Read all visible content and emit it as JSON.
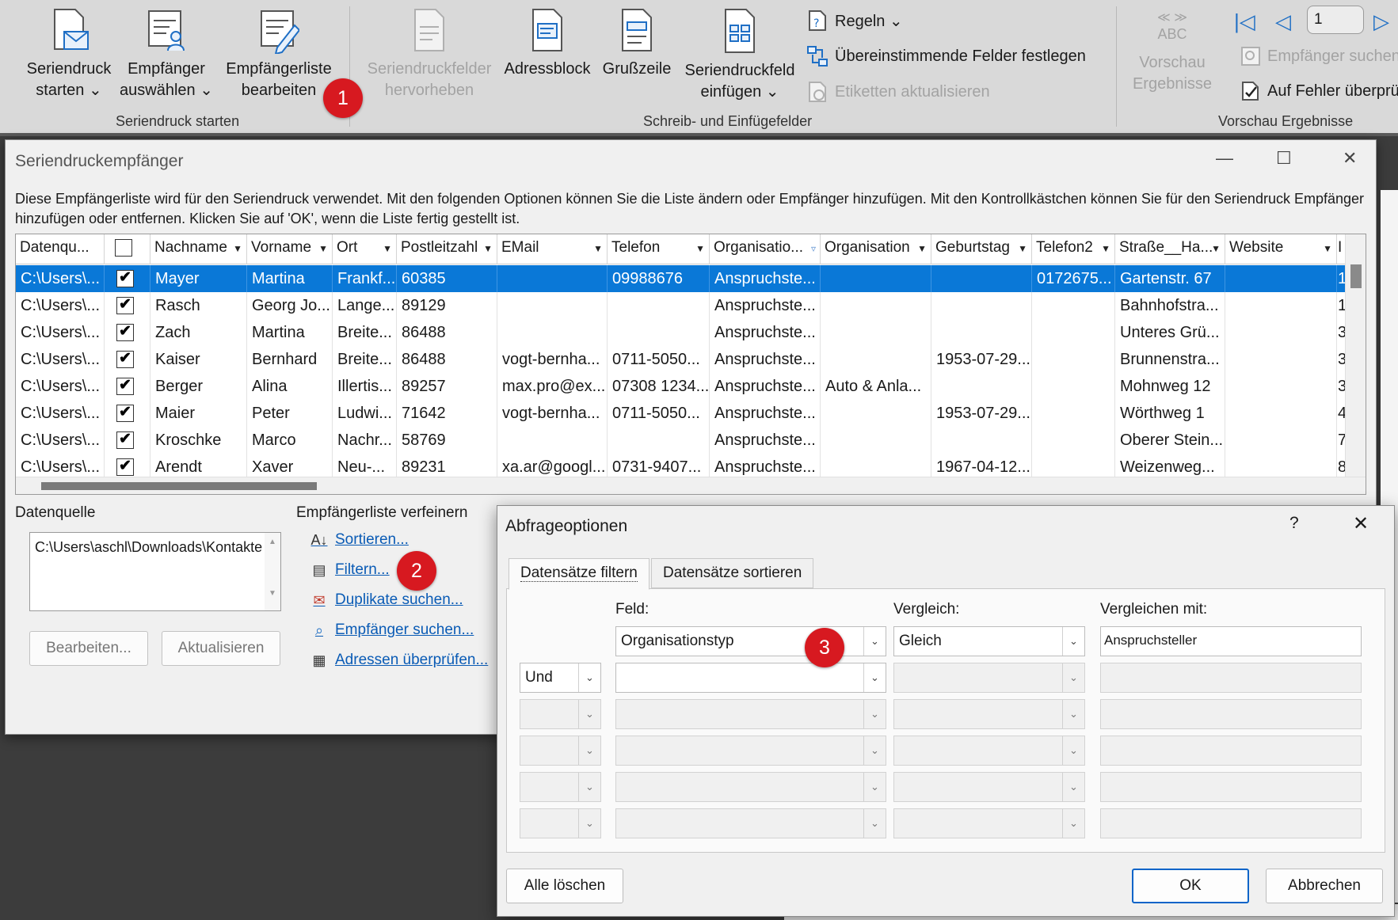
{
  "ribbon": {
    "group1": {
      "label": "Seriendruck starten",
      "btn1": {
        "l1": "Seriendruck",
        "l2": "starten ⌄",
        "icon": "mail-merge-start-icon"
      },
      "btn2": {
        "l1": "Empfänger",
        "l2": "auswählen ⌄",
        "icon": "select-recipients-icon"
      },
      "btn3": {
        "l1": "Empfängerliste",
        "l2": "bearbeiten",
        "icon": "edit-recipient-list-icon"
      }
    },
    "group2": {
      "label": "Schreib- und Einfügefelder",
      "btn1": {
        "l1": "Seriendruckfelder",
        "l2": "hervorheben"
      },
      "btn2": {
        "l1": "Adressblock"
      },
      "btn3": {
        "l1": "Grußzeile"
      },
      "btn4": {
        "l1": "Seriendruckfeld",
        "l2": "einfügen ⌄"
      },
      "rules": "Regeln ⌄",
      "match_fields": "Übereinstimmende Felder festlegen",
      "update_labels": "Etiketten aktualisieren"
    },
    "group3": {
      "label": "Vorschau Ergebnisse",
      "abc": "ABC",
      "preview_l1": "Vorschau",
      "preview_l2": "Ergebnisse",
      "record": "1",
      "find_recipient": "Empfänger suchen",
      "check_errors": "Auf Fehler überprü"
    },
    "badges": {
      "b1": "1",
      "b2": "2",
      "b3": "3"
    }
  },
  "dialog": {
    "title": "Seriendruckempfänger",
    "description": "Diese Empfängerliste wird für den Seriendruck verwendet. Mit den folgenden Optionen können Sie die Liste ändern oder Empfänger hinzufügen. Mit den Kontrollkästchen können Sie für den Seriendruck Empfänger hinzufügen oder entfernen. Klicken Sie auf 'OK', wenn die Liste fertig gestellt ist.",
    "columns": [
      "Datenqu...",
      "",
      "Nachname",
      "Vorname",
      "Ort",
      "Postleitzahl",
      "EMail",
      "Telefon",
      "Organisatio...",
      "Organisation",
      "Geburtstag",
      "Telefon2",
      "Straße__Ha...",
      "Website",
      "I"
    ],
    "rows": [
      [
        "C:\\Users\\...",
        "✔",
        "Mayer",
        "Martina",
        "Frankf...",
        "60385",
        "",
        "09988676",
        "Anspruchste...",
        "",
        "",
        "0172675...",
        "Gartenstr. 67",
        "",
        "1"
      ],
      [
        "C:\\Users\\...",
        "✔",
        "Rasch",
        "Georg Jo...",
        "Lange...",
        "89129",
        "",
        "",
        "Anspruchste...",
        "",
        "",
        "",
        "Bahnhofstra...",
        "",
        "1"
      ],
      [
        "C:\\Users\\...",
        "✔",
        "Zach",
        "Martina",
        "Breite...",
        "86488",
        "",
        "",
        "Anspruchste...",
        "",
        "",
        "",
        "Unteres Grü...",
        "",
        "3"
      ],
      [
        "C:\\Users\\...",
        "✔",
        "Kaiser",
        "Bernhard",
        "Breite...",
        "86488",
        "vogt-bernha...",
        "0711-5050...",
        "Anspruchste...",
        "",
        "1953-07-29...",
        "",
        "Brunnenstra...",
        "",
        "3"
      ],
      [
        "C:\\Users\\...",
        "✔",
        "Berger",
        "Alina",
        "Illertis...",
        "89257",
        "max.pro@ex...",
        "07308 1234...",
        "Anspruchste...",
        "Auto & Anla...",
        "",
        "",
        "Mohnweg 12",
        "",
        "3"
      ],
      [
        "C:\\Users\\...",
        "✔",
        "Maier",
        "Peter",
        "Ludwi...",
        "71642",
        "vogt-bernha...",
        "0711-5050...",
        "Anspruchste...",
        "",
        "1953-07-29...",
        "",
        "Wörthweg 1",
        "",
        "4"
      ],
      [
        "C:\\Users\\...",
        "✔",
        "Kroschke",
        "Marco",
        "Nachr...",
        "58769",
        "",
        "",
        "Anspruchste...",
        "",
        "",
        "",
        "Oberer Stein...",
        "",
        "7"
      ],
      [
        "C:\\Users\\...",
        "✔",
        "Arendt",
        "Xaver",
        "Neu-...",
        "89231",
        "xa.ar@googl...",
        "0731-9407...",
        "Anspruchste...",
        "",
        "1967-04-12...",
        "",
        "Weizenweg...",
        "",
        "8"
      ]
    ],
    "datasource_label": "Datenquelle",
    "datasource_value": "C:\\Users\\aschl\\Downloads\\Kontakte",
    "edit_btn": "Bearbeiten...",
    "refresh_btn": "Aktualisieren",
    "refine_label": "Empfängerliste verfeinern",
    "links": [
      "Sortieren...",
      "Filtern...",
      "Duplikate suchen...",
      "Empfänger suchen...",
      "Adressen überprüfen..."
    ]
  },
  "query": {
    "title": "Abfrageoptionen",
    "help": "?",
    "tab_filter": "Datensätze filtern",
    "tab_sort": "Datensätze sortieren",
    "field_label": "Feld:",
    "compare_label": "Vergleich:",
    "compare_with_label": "Vergleichen mit:",
    "row1": {
      "field": "Organisationstyp",
      "compare": "Gleich",
      "value": "Anspruchsteller"
    },
    "row2": {
      "conj": "Und"
    },
    "clear_btn": "Alle löschen",
    "ok_btn": "OK",
    "cancel_btn": "Abbrechen"
  }
}
